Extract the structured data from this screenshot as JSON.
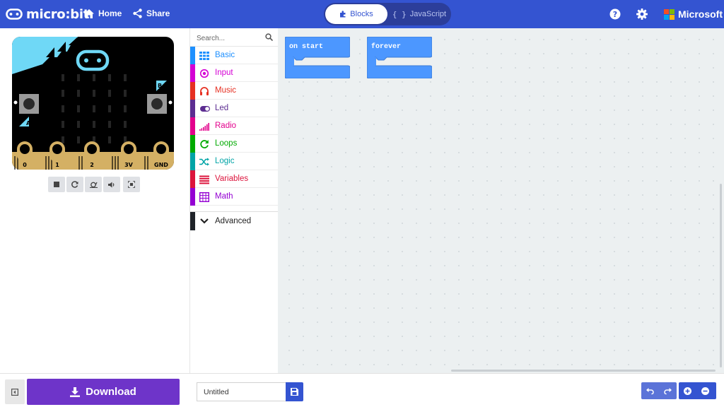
{
  "header": {
    "logo_text": "micro:bit",
    "home_label": "Home",
    "share_label": "Share",
    "blocks_label": "Blocks",
    "javascript_label": "JavaScript",
    "microsoft_label": "Microsoft",
    "accent": "#3454d1"
  },
  "simulator": {
    "pin_labels": [
      "0",
      "1",
      "2",
      "3V",
      "GND"
    ],
    "button_a": "A",
    "button_b": "B"
  },
  "toolbox": {
    "search_placeholder": "Search...",
    "categories": [
      {
        "label": "Basic",
        "color": "#1e90ff",
        "icon": "grid-icon"
      },
      {
        "label": "Input",
        "color": "#d400d4",
        "icon": "target-icon"
      },
      {
        "label": "Music",
        "color": "#e63022",
        "icon": "headphones-icon"
      },
      {
        "label": "Led",
        "color": "#5c2d91",
        "icon": "toggle-icon"
      },
      {
        "label": "Radio",
        "color": "#e3008c",
        "icon": "signal-icon"
      },
      {
        "label": "Loops",
        "color": "#00aa00",
        "icon": "refresh-icon"
      },
      {
        "label": "Logic",
        "color": "#00a4a6",
        "icon": "shuffle-icon"
      },
      {
        "label": "Variables",
        "color": "#dc143c",
        "icon": "lines-icon"
      },
      {
        "label": "Math",
        "color": "#9400d3",
        "icon": "calculator-icon"
      }
    ],
    "advanced_label": "Advanced"
  },
  "workspace": {
    "blocks": [
      {
        "label": "on start",
        "color": "#4c97ff"
      },
      {
        "label": "forever",
        "color": "#4c97ff"
      }
    ]
  },
  "footer": {
    "download_label": "Download",
    "project_name": "Untitled",
    "download_color": "#6e34c9"
  }
}
